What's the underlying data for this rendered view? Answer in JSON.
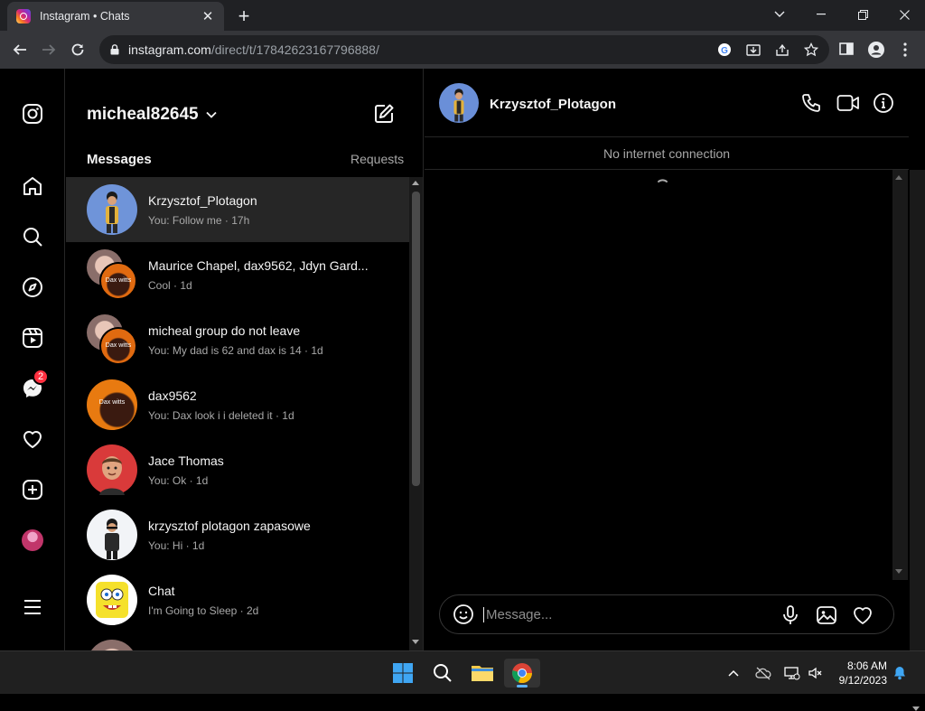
{
  "browser": {
    "tab_title": "Instagram • Chats",
    "url_domain": "instagram.com",
    "url_path": "/direct/t/17842623167796888/"
  },
  "rail": {
    "messages_badge": "2"
  },
  "inbox": {
    "username": "micheal82645",
    "messages_label": "Messages",
    "requests_label": "Requests",
    "threads": [
      {
        "name": "Krzysztof_Plotagon",
        "preview": "You: Follow me · 17h",
        "avatar_text": ""
      },
      {
        "name": "Maurice Chapel, dax9562, Jdyn Gard...",
        "preview": "Cool · 1d",
        "avatar_text": "Dax witts"
      },
      {
        "name": "micheal group do not leave",
        "preview": "You: My dad is 62 and dax is 14 · 1d",
        "avatar_text": "Dax witts"
      },
      {
        "name": "dax9562",
        "preview": "You: Dax look i i deleted it · 1d",
        "avatar_text": "Dax witts"
      },
      {
        "name": "Jace Thomas",
        "preview": "You: Ok · 1d",
        "avatar_text": ""
      },
      {
        "name": "krzysztof plotagon zapasowe",
        "preview": "You: Hi · 1d",
        "avatar_text": ""
      },
      {
        "name": "Chat",
        "preview": "I'm Going to Sleep · 2d",
        "avatar_text": ""
      }
    ]
  },
  "chat": {
    "name": "Krzysztof_Plotagon",
    "status": "No internet connection",
    "placeholder": "Message..."
  },
  "taskbar": {
    "time": "8:06 AM",
    "date": "9/12/2023"
  },
  "colors": {
    "accent_badge": "#ff3040",
    "active_row": "#262626",
    "background": "#000000"
  }
}
